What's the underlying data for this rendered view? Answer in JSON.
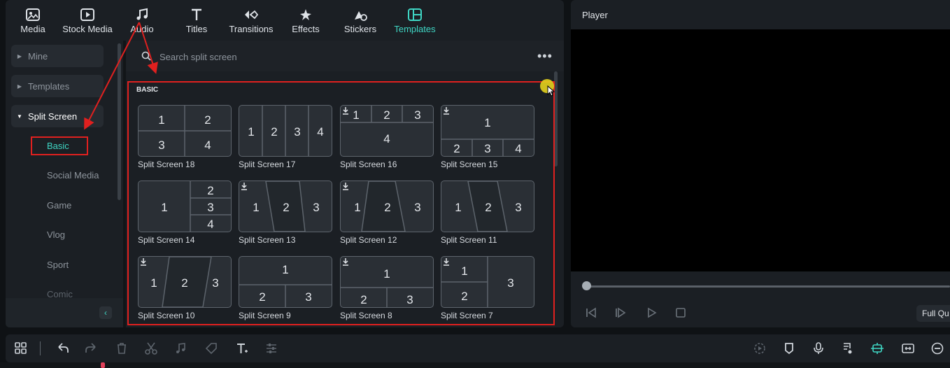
{
  "toolbar": {
    "items": [
      {
        "label": "Media",
        "icon": "media-icon"
      },
      {
        "label": "Stock Media",
        "icon": "stock-media-icon"
      },
      {
        "label": "Audio",
        "icon": "audio-icon"
      },
      {
        "label": "Titles",
        "icon": "titles-icon"
      },
      {
        "label": "Transitions",
        "icon": "transitions-icon"
      },
      {
        "label": "Effects",
        "icon": "effects-icon"
      },
      {
        "label": "Stickers",
        "icon": "stickers-icon"
      },
      {
        "label": "Templates",
        "icon": "templates-icon"
      }
    ],
    "active": "Templates"
  },
  "categories": {
    "tree": [
      {
        "label": "Mine",
        "expanded": false
      },
      {
        "label": "Templates",
        "expanded": false
      },
      {
        "label": "Split Screen",
        "expanded": true
      }
    ],
    "subitems": [
      "Basic",
      "Social Media",
      "Game",
      "Vlog",
      "Sport",
      "Comic"
    ],
    "selected": "Basic"
  },
  "search": {
    "placeholder": "Search split screen"
  },
  "section": {
    "title": "BASIC"
  },
  "templates": [
    {
      "label": "Split Screen 18",
      "download": false
    },
    {
      "label": "Split Screen 17",
      "download": false
    },
    {
      "label": "Split Screen 16",
      "download": true
    },
    {
      "label": "Split Screen 15",
      "download": true
    },
    {
      "label": "Split Screen 14",
      "download": false
    },
    {
      "label": "Split Screen 13",
      "download": true
    },
    {
      "label": "Split Screen 12",
      "download": true
    },
    {
      "label": "Split Screen 11",
      "download": false
    },
    {
      "label": "Split Screen 10",
      "download": true
    },
    {
      "label": "Split Screen 9",
      "download": false
    },
    {
      "label": "Split Screen 8",
      "download": true
    },
    {
      "label": "Split Screen 7",
      "download": true
    }
  ],
  "player": {
    "title": "Player",
    "quality": "Full Qu"
  },
  "colors": {
    "accent": "#3fd6c4",
    "annotation": "#e0201f",
    "background": "#1b1f24"
  }
}
